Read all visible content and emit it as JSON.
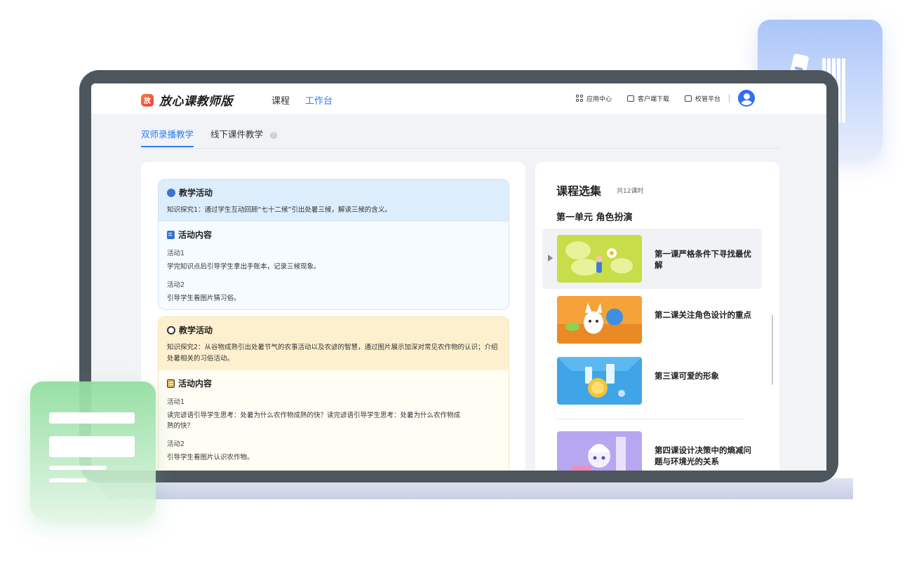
{
  "app": {
    "logo_badge": "放",
    "name": "放心课教师版"
  },
  "nav": {
    "items": [
      {
        "label": "课程",
        "active": false
      },
      {
        "label": "工作台",
        "active": true
      }
    ]
  },
  "top_right": {
    "app_center": "应用中心",
    "client_download": "客户端下载",
    "school_platform": "校管平台"
  },
  "subtabs": {
    "tab1": "双师录播教学",
    "tab2": "线下课件教学",
    "help": "?"
  },
  "activities": [
    {
      "title": "教学活动",
      "desc": "知识探究1：通过学生互动回顾“七十二候”引出处暑三候，解读三候的含义。",
      "content_title": "活动内容",
      "items": [
        {
          "label": "活动1",
          "text": "学完知识点后引导学生拿出手账本，记录三候现象。"
        },
        {
          "label": "活动2",
          "text": "引导学生看图片猜习俗。"
        }
      ]
    },
    {
      "title": "教学活动",
      "desc": "知识探究2：从谷物成熟引出处暑节气的农事活动以及农谚的智慧，通过图片展示加深对常见农作物的认识；介绍处暑相关的习俗活动。",
      "content_title": "活动内容",
      "items": [
        {
          "label": "活动1",
          "text": "读完谚语引导学生思考：处暑为什么农作物成熟的快？读完谚语引导学生思考：处暑为什么农作物成熟的快？"
        },
        {
          "label": "活动2",
          "text": "引导学生看图片认识农作物。"
        }
      ]
    }
  ],
  "course": {
    "title": "课程选集",
    "count": "共12课时",
    "unit": "第一单元 角色扮演",
    "lessons": [
      {
        "title": "第一课严格条件下寻找最优解",
        "thumb_color": "#c7dd4a",
        "active": true
      },
      {
        "title": "第二课关注角色设计的重点",
        "thumb_color": "#f6a23a",
        "active": false
      },
      {
        "title": "第三课可爱的形象",
        "thumb_color": "#3fa5e6",
        "active": false
      },
      {
        "title": "第四课设计决策中的熵减问题与环境光的关系",
        "thumb_color": "#b7a6f0",
        "active": false
      }
    ]
  },
  "colors": {
    "accent": "#2d7cf6",
    "frame": "#4e565d"
  }
}
